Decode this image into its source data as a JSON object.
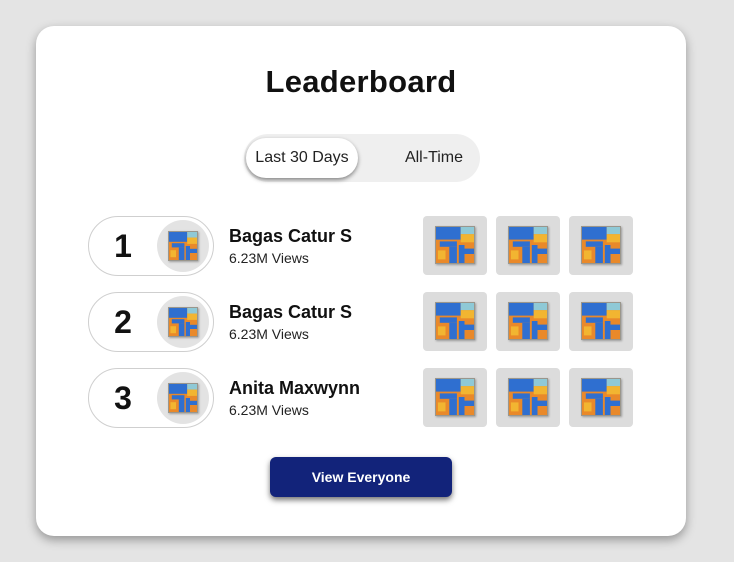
{
  "title": "Leaderboard",
  "tabs": [
    {
      "label": "Last 30 Days",
      "active": true
    },
    {
      "label": "All-Time",
      "active": false
    }
  ],
  "entries": [
    {
      "rank": "1",
      "name": "Bagas Catur S",
      "views": "6.23M Views"
    },
    {
      "rank": "2",
      "name": "Bagas Catur S",
      "views": "6.23M Views"
    },
    {
      "rank": "3",
      "name": "Anita Maxwynn",
      "views": "6.23M Views"
    }
  ],
  "cta_label": "View Everyone",
  "colors": {
    "accent": "#12237a",
    "card": "#ffffff",
    "background": "#e4e4e4",
    "art_blue": "#2f6fd0",
    "art_orange": "#e9892a",
    "art_yellow": "#f2b531",
    "art_teal": "#8fc9d6"
  }
}
